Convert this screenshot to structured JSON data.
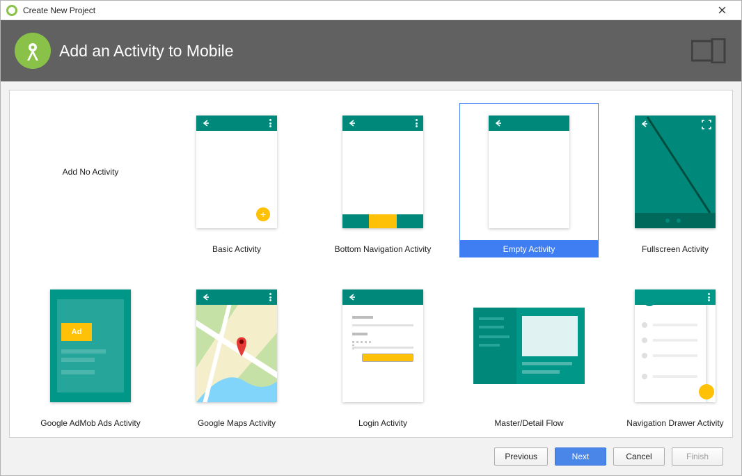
{
  "window": {
    "title": "Create New Project"
  },
  "header": {
    "heading": "Add an Activity to Mobile"
  },
  "templates": [
    {
      "id": "no-activity",
      "label": "Add No Activity",
      "selected": false
    },
    {
      "id": "basic",
      "label": "Basic Activity",
      "selected": false
    },
    {
      "id": "bottom-nav",
      "label": "Bottom Navigation Activity",
      "selected": false
    },
    {
      "id": "empty",
      "label": "Empty Activity",
      "selected": true
    },
    {
      "id": "fullscreen",
      "label": "Fullscreen Activity",
      "selected": false
    },
    {
      "id": "admob",
      "label": "Google AdMob Ads Activity",
      "selected": false
    },
    {
      "id": "maps",
      "label": "Google Maps Activity",
      "selected": false
    },
    {
      "id": "login",
      "label": "Login Activity",
      "selected": false
    },
    {
      "id": "master-detail",
      "label": "Master/Detail Flow",
      "selected": false
    },
    {
      "id": "nav-drawer",
      "label": "Navigation Drawer Activity",
      "selected": false
    }
  ],
  "ad_badge": "Ad",
  "buttons": {
    "previous": "Previous",
    "next": "Next",
    "cancel": "Cancel",
    "finish": "Finish"
  },
  "colors": {
    "brand_green": "#8ac249",
    "header_gray": "#616161",
    "teal": "#00897b",
    "amber": "#ffc107",
    "selection_blue": "#3e7ef2",
    "primary_button": "#4a86e8"
  }
}
